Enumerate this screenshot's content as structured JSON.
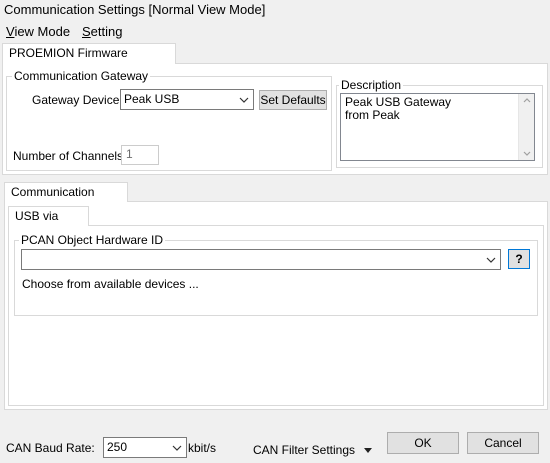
{
  "window": {
    "title": "Communication Settings [Normal View Mode]"
  },
  "menu": {
    "view_mode": {
      "accel": "V",
      "rest": "iew Mode"
    },
    "setting": {
      "accel": "S",
      "rest": "etting"
    }
  },
  "main_tab": {
    "label": "PROEMION Firmware Programmer"
  },
  "gateway": {
    "group_label": "Communication Gateway",
    "device_label": "Gateway Device:",
    "device_value": "Peak USB",
    "set_defaults_label": "Set Defaults",
    "channels_label": "Number of Channels:",
    "channels_value": "1"
  },
  "description": {
    "group_label": "Description",
    "lines": [
      "Peak USB Gateway",
      "from Peak"
    ]
  },
  "comm_device": {
    "tab_label": "Communication Device",
    "subtab_label": "USB via PCAN",
    "hw_group_label": "PCAN Object Hardware ID",
    "hw_value": "",
    "help_label": "?",
    "hint": "Choose from available devices ..."
  },
  "footer": {
    "baud_label": "CAN Baud Rate:",
    "baud_value": "250",
    "baud_unit": "kbit/s",
    "filter_label": "CAN Filter Settings",
    "ok_label": "OK",
    "cancel_label": "Cancel"
  }
}
